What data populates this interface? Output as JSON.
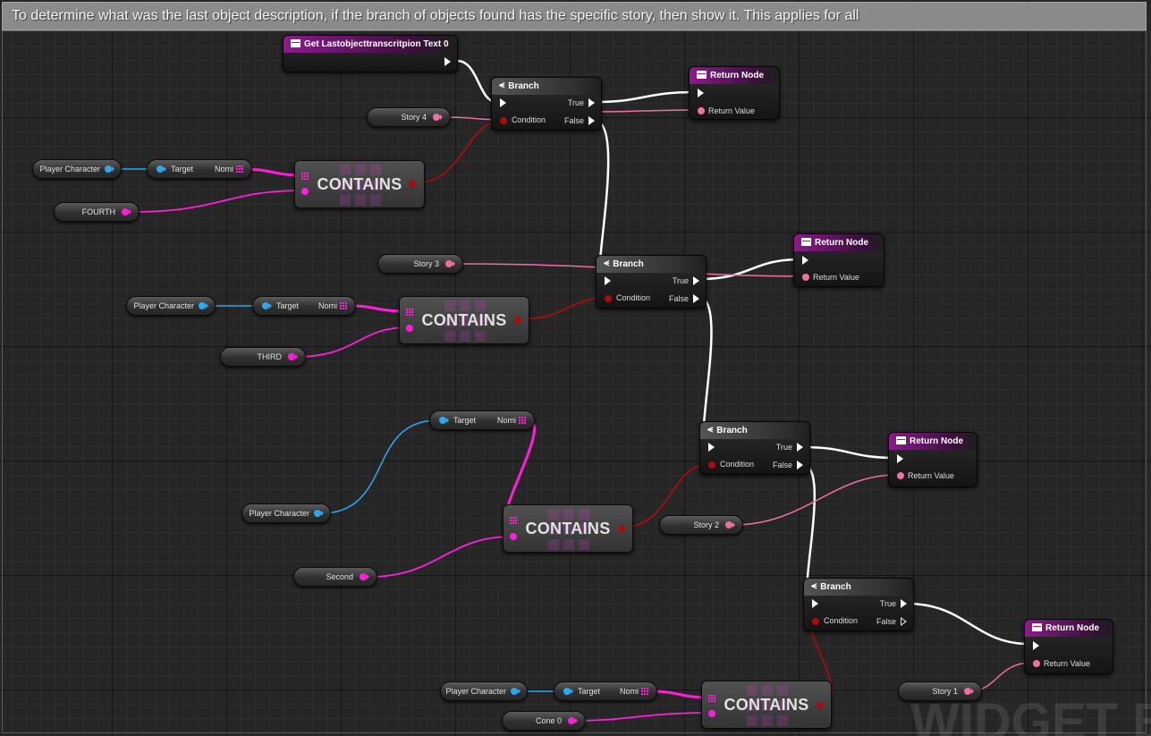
{
  "comment": {
    "text": "To determine what was the last object description, if the branch of objects found has the specific story, then show it. This applies for all"
  },
  "colors": {
    "exec_wire": "#ffffff",
    "bool_wire": "#a80d0d",
    "string_wire": "#ee6fa4",
    "object_wire": "#2aa9f2",
    "array_wire": "#ff1fd9",
    "function_header": "#8c1b8c",
    "grid_background": "#262626"
  },
  "getter": {
    "title": "Get Lastobjecttranscritpion Text 0",
    "icon": "function-icon"
  },
  "branches": [
    {
      "title": "Branch",
      "condition": "Condition",
      "true_label": "True",
      "false_label": "False"
    },
    {
      "title": "Branch",
      "condition": "Condition",
      "true_label": "True",
      "false_label": "False"
    },
    {
      "title": "Branch",
      "condition": "Condition",
      "true_label": "True",
      "false_label": "False"
    },
    {
      "title": "Branch",
      "condition": "Condition",
      "true_label": "True",
      "false_label": "False"
    }
  ],
  "return_nodes": [
    {
      "title": "Return Node",
      "value_label": "Return Value"
    },
    {
      "title": "Return Node",
      "value_label": "Return Value"
    },
    {
      "title": "Return Node",
      "value_label": "Return Value"
    },
    {
      "title": "Return Node",
      "value_label": "Return Value"
    }
  ],
  "contains_nodes": [
    {
      "label": "CONTAINS"
    },
    {
      "label": "CONTAINS"
    },
    {
      "label": "CONTAINS"
    },
    {
      "label": "CONTAINS"
    }
  ],
  "stories": [
    "Story 4",
    "Story 3",
    "Story 2",
    "Story 1"
  ],
  "player_character": [
    "Player Character",
    "Player Character",
    "Player Character",
    "Player Character"
  ],
  "target_nodes": [
    {
      "target": "Target",
      "output": "Nomi"
    },
    {
      "target": "Target",
      "output": "Nomi"
    },
    {
      "target": "Target",
      "output": "Nomi"
    },
    {
      "target": "Target",
      "output": "Nomi"
    }
  ],
  "search_items": [
    "FOURTH",
    "THIRD",
    "Second",
    "Cone 0"
  ],
  "watermark": "WIDGET B"
}
